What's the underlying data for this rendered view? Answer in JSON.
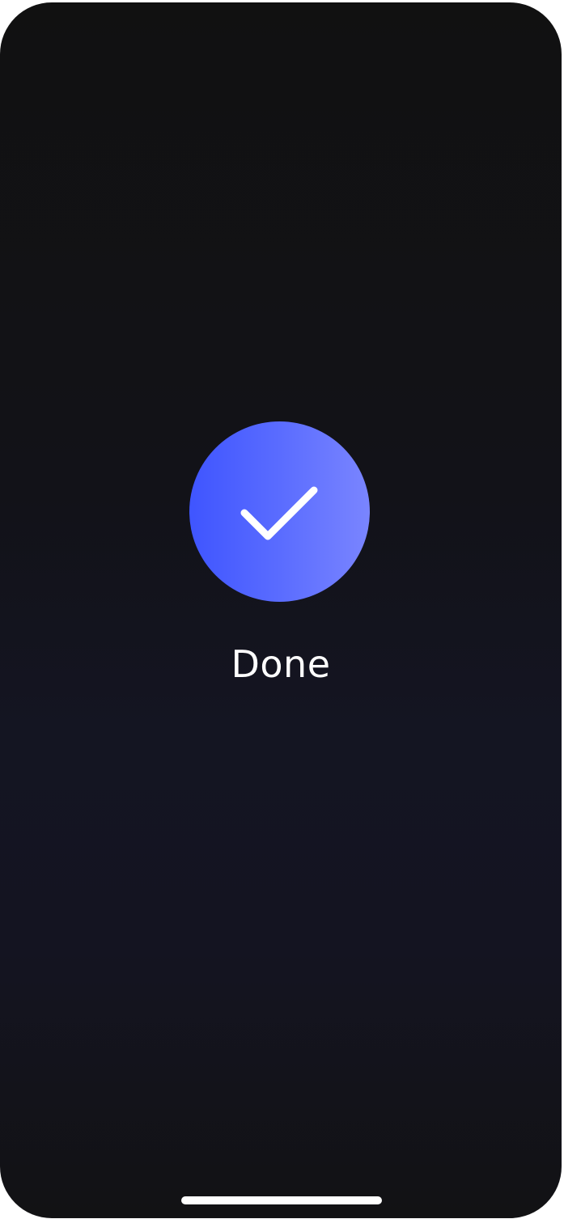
{
  "screen": {
    "status_text": "Done",
    "icon": "checkmark-icon",
    "colors": {
      "background_top": "#111111",
      "background_mid": "#141522",
      "accent_start": "#3f55ff",
      "accent_end": "#7a85ff",
      "text": "#ffffff"
    }
  }
}
